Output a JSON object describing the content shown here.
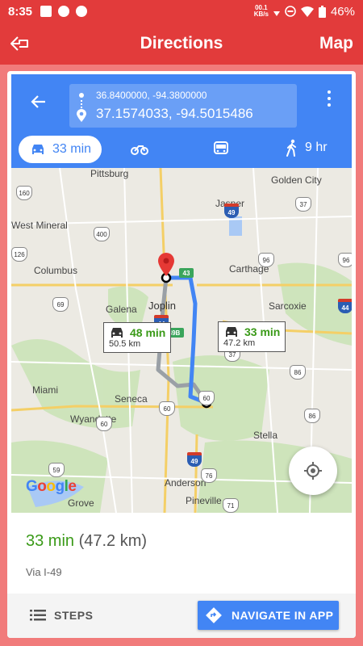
{
  "status_bar": {
    "time": "8:35",
    "speed_value": "00.1",
    "speed_unit": "KB/s",
    "battery": "46%"
  },
  "app_bar": {
    "title": "Directions",
    "action": "Map"
  },
  "route_inputs": {
    "origin": "36.8400000, -94.3800000",
    "destination": "37.1574033, -94.5015486"
  },
  "travel_modes": {
    "car_time": "33 min",
    "walk_time": "9 hr"
  },
  "map": {
    "places": {
      "pittsburg": "Pittsburg",
      "golden_city": "Golden City",
      "jasper": "Jasper",
      "west_mineral": "West Mineral",
      "columbus": "Columbus",
      "carthage": "Carthage",
      "galena": "Galena",
      "joplin": "Joplin",
      "sarcoxie": "Sarcoxie",
      "miami": "Miami",
      "seneca": "Seneca",
      "wyandotte": "Wyandotte",
      "stella": "Stella",
      "anderson": "Anderson",
      "grove": "Grove",
      "pineville": "Pineville"
    },
    "route_shields": {
      "r160": "160",
      "r37a": "37",
      "r49a": "49",
      "r400": "400",
      "r126": "126",
      "r69": "69",
      "r43": "43",
      "r96": "96",
      "r44a": "44",
      "r44b": "44",
      "r49b": "49B",
      "r37b": "37",
      "r86": "86",
      "r60a": "60",
      "r60b": "60",
      "r59": "59",
      "r49c": "49",
      "r76": "76",
      "r71": "71"
    },
    "alt_route": {
      "time": "48 min",
      "distance": "50.5 km"
    },
    "main_route": {
      "time": "33 min",
      "distance": "47.2 km"
    },
    "logo_letters": [
      "G",
      "o",
      "o",
      "g",
      "l",
      "e"
    ]
  },
  "summary": {
    "duration": "33 min",
    "distance": "(47.2 km)",
    "via": "Via I-49"
  },
  "footer": {
    "steps_label": "STEPS",
    "navigate_label": "NAVIGATE IN APP"
  },
  "colors": {
    "app_red": "#e23b3b",
    "maps_blue": "#4285f4",
    "route_green": "#3a9a18"
  }
}
